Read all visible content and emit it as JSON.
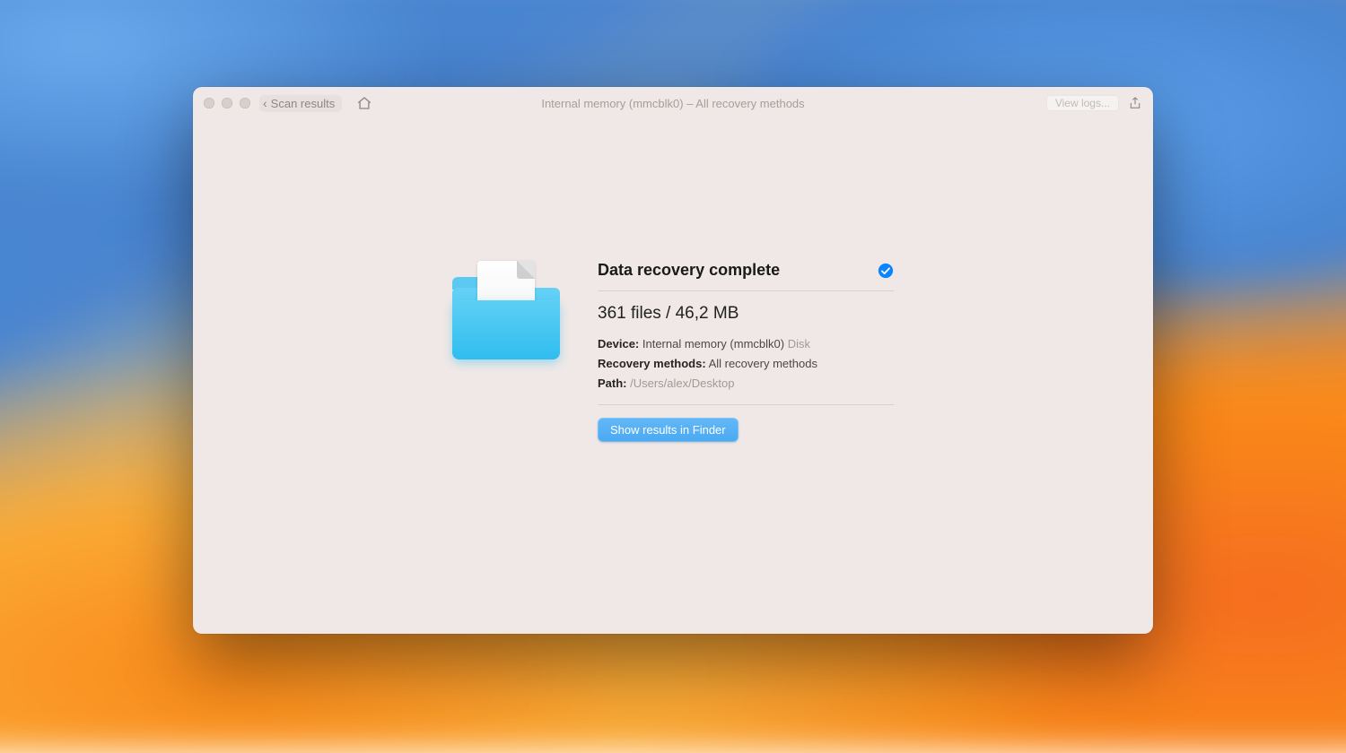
{
  "toolbar": {
    "back_label": "Scan results",
    "window_title": "Internal memory (mmcblk0) – All recovery methods",
    "view_logs_label": "View logs..."
  },
  "result": {
    "headline": "Data recovery complete",
    "summary_line": "361 files / 46,2 MB",
    "device_label": "Device:",
    "device_value": "Internal memory (mmcblk0)",
    "device_suffix": "Disk",
    "methods_label": "Recovery methods:",
    "methods_value": "All recovery methods",
    "path_label": "Path:",
    "path_value": "/Users/alex/Desktop",
    "primary_button": "Show results in Finder"
  }
}
